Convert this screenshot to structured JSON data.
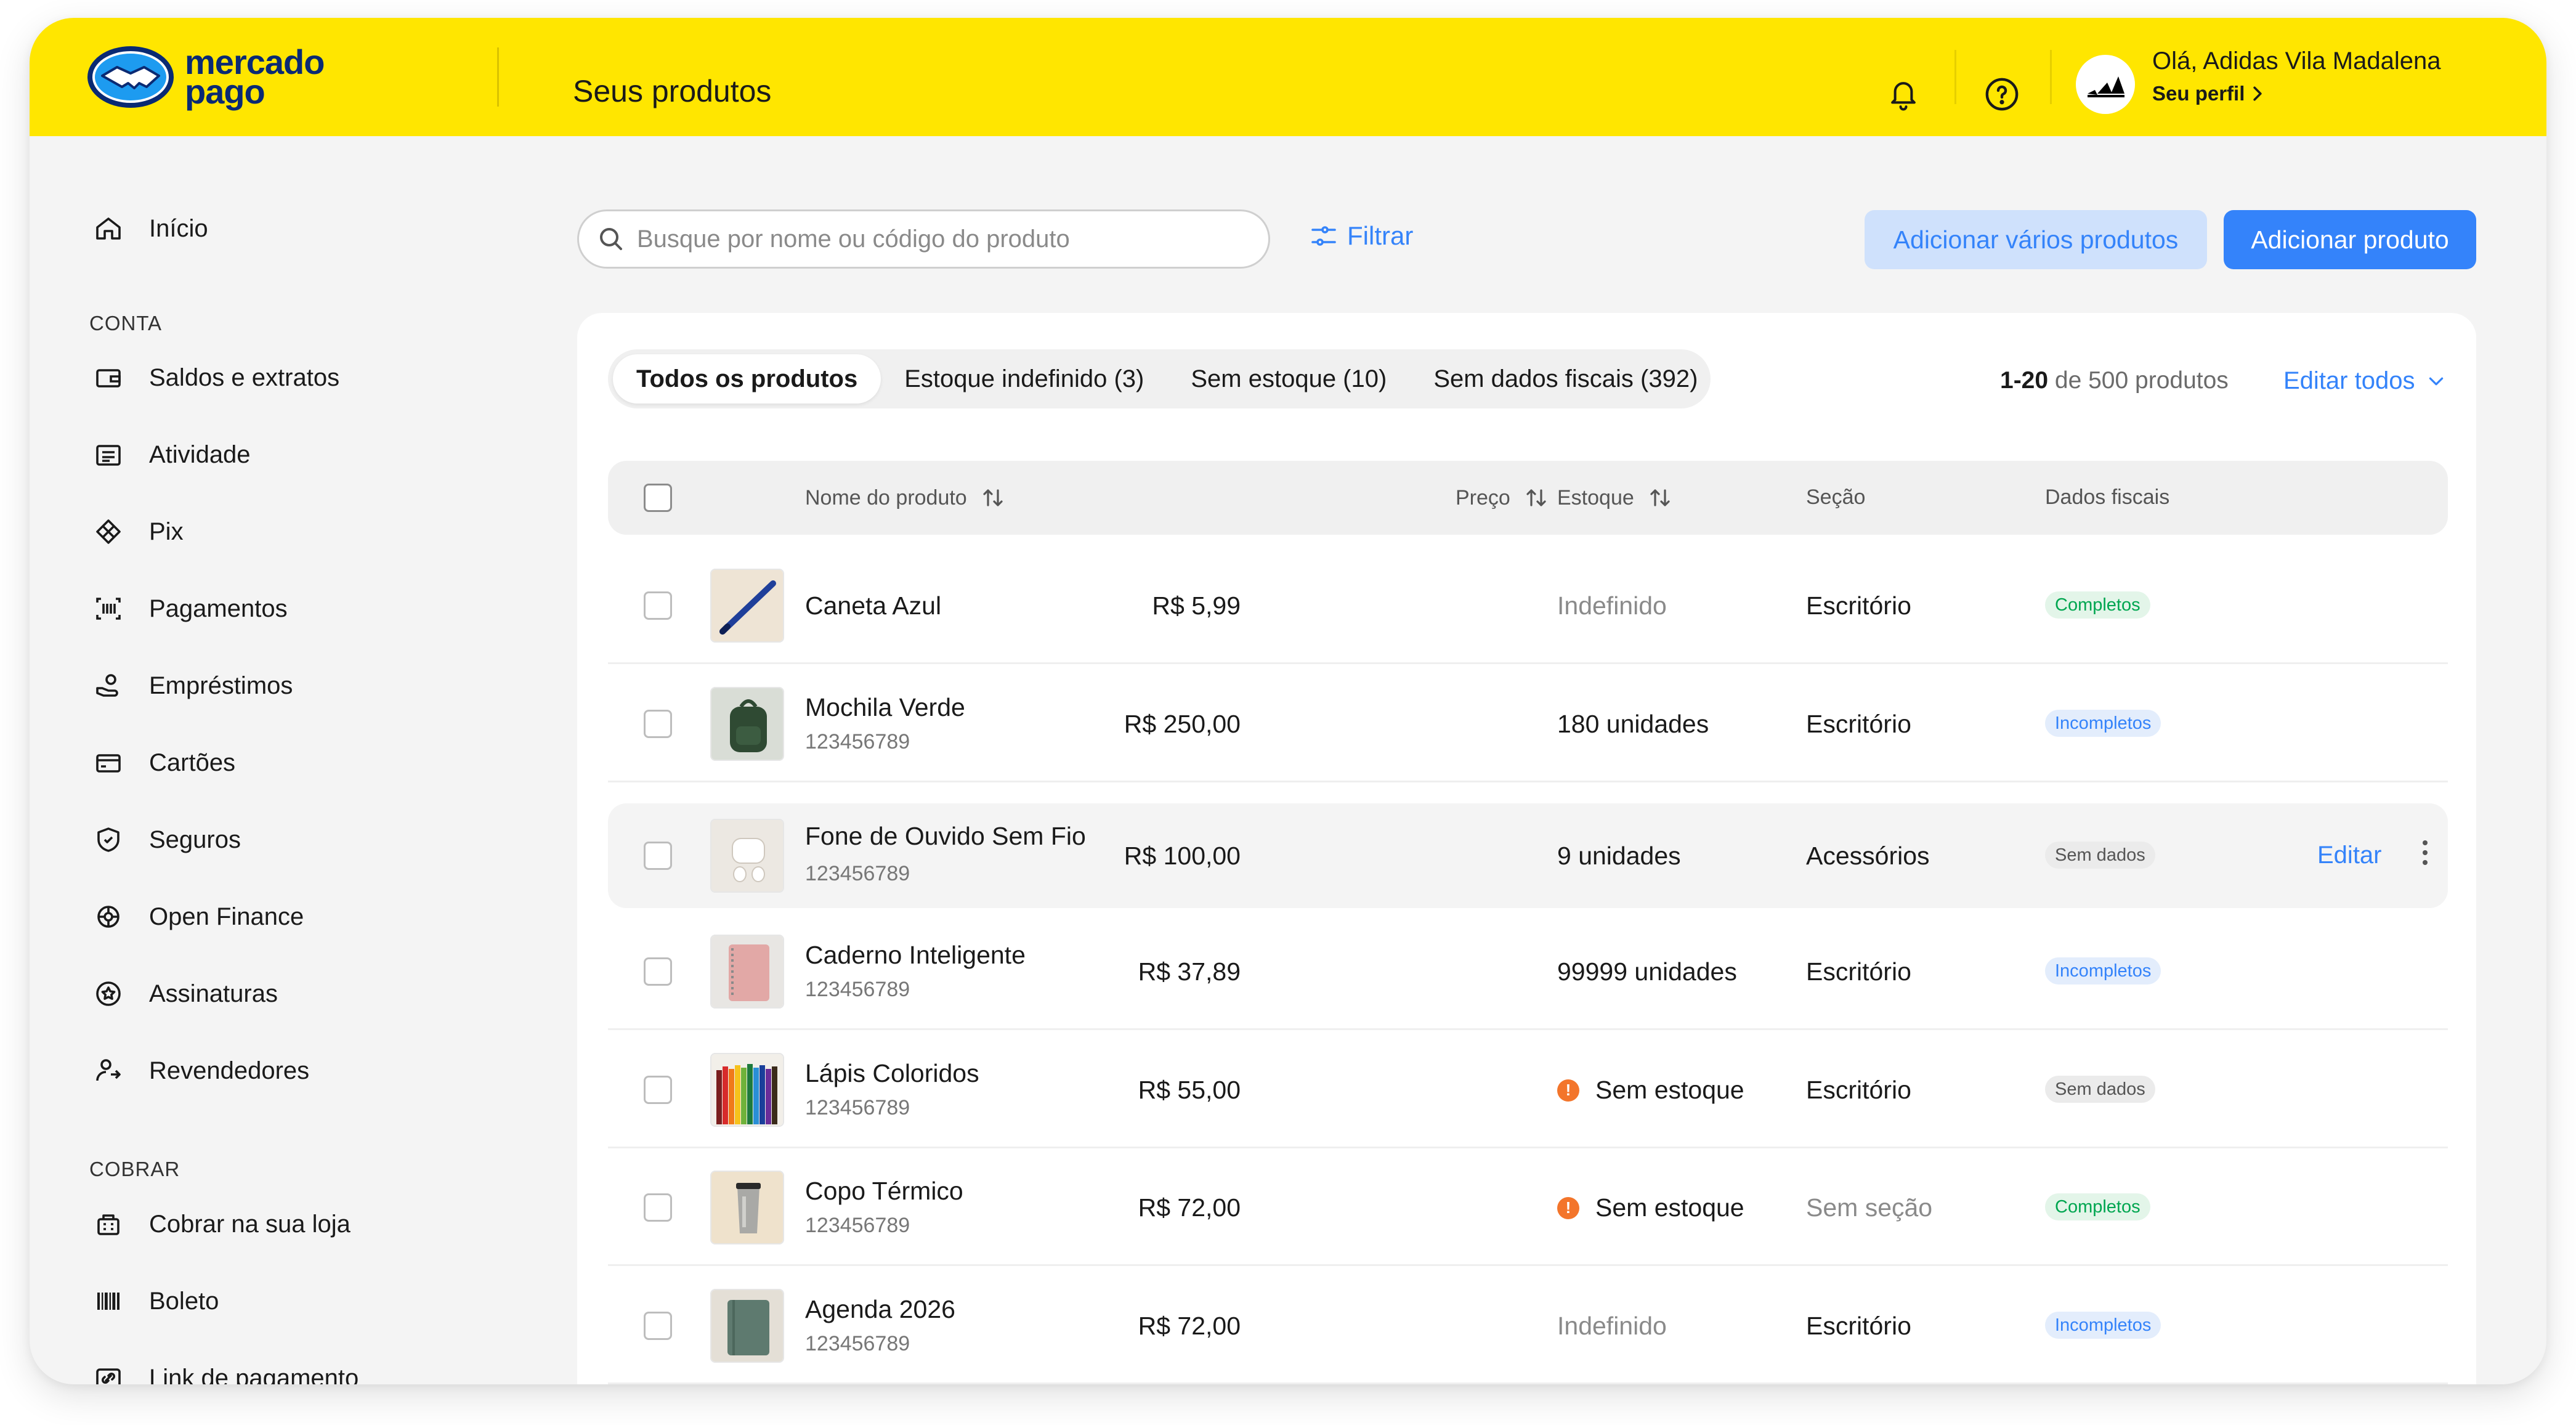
{
  "header": {
    "logo_line1": "mercado",
    "logo_line2": "pago",
    "title": "Seus produtos",
    "greeting": "Olá, Adidas Vila Madalena",
    "profile_link": "Seu perfil",
    "icons": [
      "bell-icon",
      "help-icon",
      "adidas-avatar",
      "chevron-right-icon"
    ]
  },
  "sidebar": {
    "home": "Início",
    "section_account": "CONTA",
    "account_items": [
      {
        "label": "Saldos e extratos",
        "icon": "wallet-icon"
      },
      {
        "label": "Atividade",
        "icon": "list-icon"
      },
      {
        "label": "Pix",
        "icon": "pix-icon"
      },
      {
        "label": "Pagamentos",
        "icon": "payments-icon"
      },
      {
        "label": "Empréstimos",
        "icon": "loan-icon"
      },
      {
        "label": "Cartões",
        "icon": "card-icon"
      },
      {
        "label": "Seguros",
        "icon": "shield-icon"
      },
      {
        "label": "Open Finance",
        "icon": "open-finance-icon"
      },
      {
        "label": "Assinaturas",
        "icon": "subscription-icon"
      },
      {
        "label": "Revendedores",
        "icon": "resellers-icon"
      }
    ],
    "section_charge": "COBRAR",
    "charge_items": [
      {
        "label": "Cobrar na sua loja",
        "icon": "store-icon"
      },
      {
        "label": "Boleto",
        "icon": "barcode-icon"
      },
      {
        "label": "Link de pagamento",
        "icon": "link-icon"
      }
    ]
  },
  "toolbar": {
    "search_placeholder": "Busque por nome ou código do produto",
    "filter_label": "Filtrar",
    "add_many_label": "Adicionar vários produtos",
    "add_label": "Adicionar produto"
  },
  "tabs": [
    "Todos os produtos",
    "Estoque indefinido (3)",
    "Sem estoque (10)",
    "Sem dados fiscais (392)"
  ],
  "pagination": {
    "range": "1-20",
    "of_text": "de 500 produtos",
    "edit_all": "Editar todos"
  },
  "table": {
    "columns": [
      "Nome do produto",
      "Preço",
      "Estoque",
      "Seção",
      "Dados fiscais"
    ],
    "rows": [
      {
        "name": "Caneta Azul",
        "code": "",
        "price": "R$ 5,99",
        "stock": "Indefinido",
        "stock_state": "undefined",
        "section": "Escritório",
        "fiscal": "Completos",
        "fiscal_state": "ok"
      },
      {
        "name": "Mochila Verde",
        "code": "123456789",
        "price": "R$ 250,00",
        "stock": "180 unidades",
        "stock_state": "normal",
        "section": "Escritório",
        "fiscal": "Incompletos",
        "fiscal_state": "inc"
      },
      {
        "name": "Fone de Ouvido Sem Fio",
        "code": "123456789",
        "price": "R$ 100,00",
        "stock": "9 unidades",
        "stock_state": "normal",
        "section": "Acessórios",
        "fiscal": "Sem dados",
        "fiscal_state": "none",
        "edit": "Editar"
      },
      {
        "name": "Caderno Inteligente",
        "code": "123456789",
        "price": "R$ 37,89",
        "stock": "99999 unidades",
        "stock_state": "normal",
        "section": "Escritório",
        "fiscal": "Incompletos",
        "fiscal_state": "inc"
      },
      {
        "name": "Lápis Coloridos",
        "code": "123456789",
        "price": "R$ 55,00",
        "stock": "Sem estoque",
        "stock_state": "out",
        "section": "Escritório",
        "fiscal": "Sem dados",
        "fiscal_state": "none"
      },
      {
        "name": "Copo Térmico",
        "code": "123456789",
        "price": "R$ 72,00",
        "stock": "Sem estoque",
        "stock_state": "out",
        "section": "Sem seção",
        "fiscal": "Completos",
        "fiscal_state": "ok"
      },
      {
        "name": "Agenda 2026",
        "code": "123456789",
        "price": "R$ 72,00",
        "stock": "Indefinido",
        "stock_state": "undefined",
        "section": "Escritório",
        "fiscal": "Incompletos",
        "fiscal_state": "inc"
      }
    ]
  },
  "colors": {
    "brand_yellow": "#ffe600",
    "brand_blue": "#3483fa",
    "success_green": "#00a650",
    "warning_orange": "#f3752b"
  }
}
